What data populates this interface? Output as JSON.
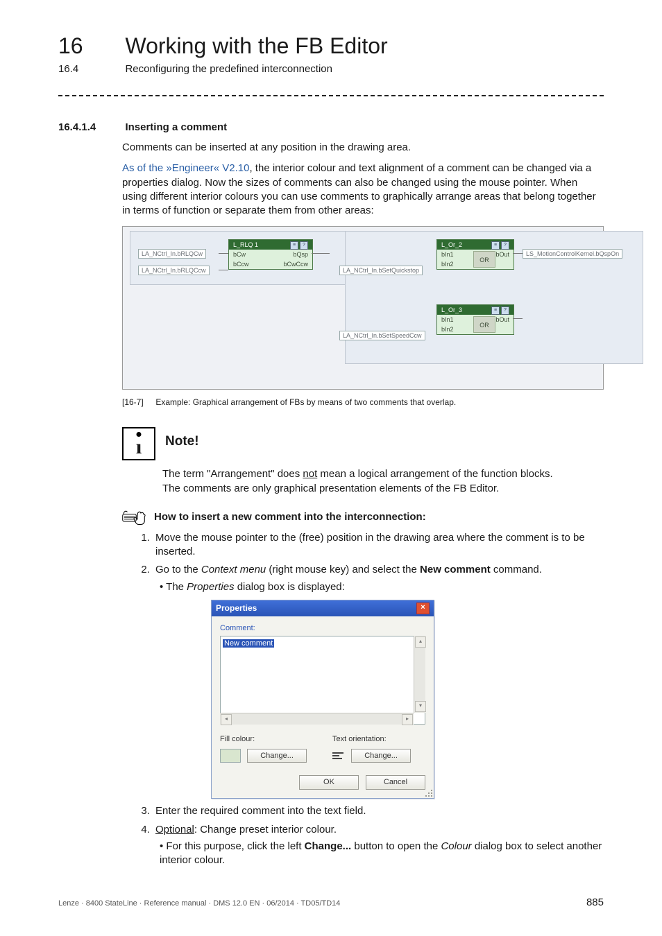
{
  "header": {
    "chapter_no": "16",
    "chapter_title": "Working with the FB Editor",
    "sub_no": "16.4",
    "sub_title": "Reconfiguring the predefined interconnection"
  },
  "section": {
    "no": "16.4.1.4",
    "title": "Inserting a comment",
    "p1": "Comments can be inserted at any position in the drawing area.",
    "p2_lead": "As of the »Engineer« V2.10",
    "p2_rest": ", the interior colour and text alignment of a comment can be changed via a properties dialog. Now the sizes of comments can also be changed using the mouse pointer. When using different interior colours you can use comments to graphically arrange areas that belong together in terms of function or separate them from other areas:"
  },
  "figure": {
    "ports": {
      "p1": "LA_NCtrl_In.bRLQCw",
      "p2": "LA_NCtrl_In.bRLQCcw",
      "p3": "LA_NCtrl_In.bSetQuickstop",
      "p4": "LA_NCtrl_In.bSetSpeedCcw",
      "p5": "LS_MotionControlKernel.bQspOn"
    },
    "fb_rlq": {
      "title": "L_RLQ 1",
      "r1l": "bCw",
      "r1r": "bQsp",
      "r2l": "bCcw",
      "r2r": "bCwCcw"
    },
    "fb_or2": {
      "title": "L_Or_2",
      "r1l": "bIn1",
      "r1r": "bOut",
      "r2l": "bIn2",
      "mid": "OR"
    },
    "fb_or3": {
      "title": "L_Or_3",
      "r1l": "bIn1",
      "r1r": "bOut",
      "r2l": "bIn2",
      "mid": "OR"
    },
    "caption_tag": "[16-7]",
    "caption_text": "Example: Graphical arrangement of FBs by means of two comments that overlap."
  },
  "note": {
    "title": "Note!",
    "l1a": "The term \"Arrangement\" does ",
    "l1u": "not",
    "l1b": " mean a logical arrangement of the function blocks.",
    "l2": "The comments are only graphical presentation elements of the FB Editor."
  },
  "howto": {
    "title": "How to insert a new comment into the interconnection:",
    "s1": "Move the mouse pointer to the (free) position in the drawing area where the comment is to be inserted.",
    "s2a": "Go to the ",
    "s2i1": "Context menu",
    "s2b": " (right mouse key) and select the ",
    "s2bold": "New comment",
    "s2c": " command.",
    "s2_sub_a": "The ",
    "s2_sub_i": "Properties",
    "s2_sub_b": " dialog box is displayed:",
    "s3": "Enter the required comment into the text field.",
    "s4_u": "Optional",
    "s4_rest": ": Change preset interior colour.",
    "s4_sub_a": "For this purpose, click the left ",
    "s4_sub_bold": "Change...",
    "s4_sub_b": " button to open the ",
    "s4_sub_i": "Colour",
    "s4_sub_c": " dialog box to select another interior colour."
  },
  "dialog": {
    "title": "Properties",
    "comment_label": "Comment:",
    "comment_value": "New comment",
    "fill_label": "Fill colour:",
    "orient_label": "Text orientation:",
    "change": "Change...",
    "ok": "OK",
    "cancel": "Cancel"
  },
  "footer": {
    "left": "Lenze · 8400 StateLine · Reference manual · DMS 12.0 EN · 06/2014 · TD05/TD14",
    "page": "885"
  }
}
